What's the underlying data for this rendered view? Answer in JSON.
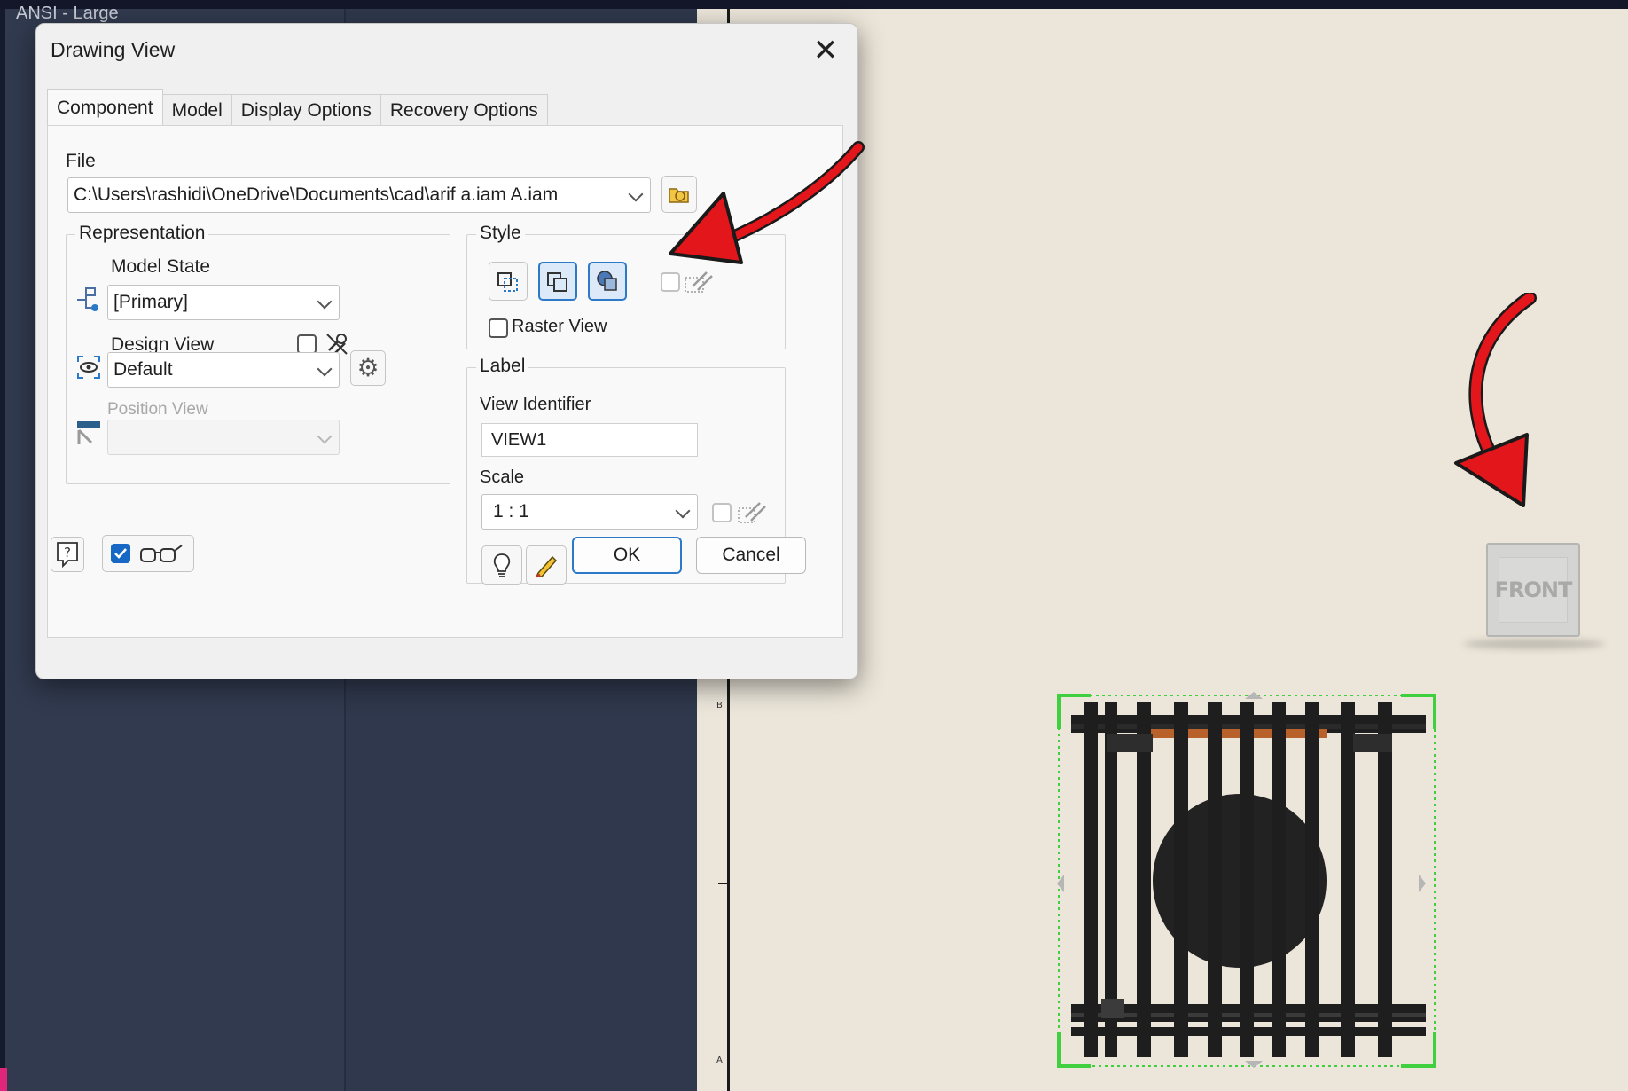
{
  "app": {
    "sheet_title": "ANSI - Large"
  },
  "dialog": {
    "title": "Drawing View",
    "tabs": [
      "Component",
      "Model",
      "Display Options",
      "Recovery Options"
    ],
    "active_tab": "Component",
    "file": {
      "label": "File",
      "value": "C:\\Users\\rashidi\\OneDrive\\Documents\\cad\\arif a.iam A.iam"
    },
    "representation": {
      "title": "Representation",
      "model_state_label": "Model State",
      "model_state_value": "[Primary]",
      "design_view_label": "Design View",
      "design_view_value": "Default",
      "position_view_label": "Position View",
      "position_view_value": ""
    },
    "style": {
      "title": "Style",
      "raster_view_label": "Raster View",
      "raster_view_checked": false,
      "selected_style": "shaded"
    },
    "label": {
      "title": "Label",
      "view_identifier_label": "View Identifier",
      "view_identifier_value": "VIEW1",
      "scale_label": "Scale",
      "scale_value": "1 : 1"
    },
    "footer": {
      "ok_label": "OK",
      "cancel_label": "Cancel",
      "preview_checked": true
    }
  },
  "sheet": {
    "view_cube_face": "FRONT",
    "zone_labels": [
      "B",
      "A"
    ]
  },
  "colors": {
    "accent": "#2c79c8",
    "arrow": "#e3161b",
    "sheet_bg": "#ece6da",
    "selection": "#3fcf3f"
  }
}
